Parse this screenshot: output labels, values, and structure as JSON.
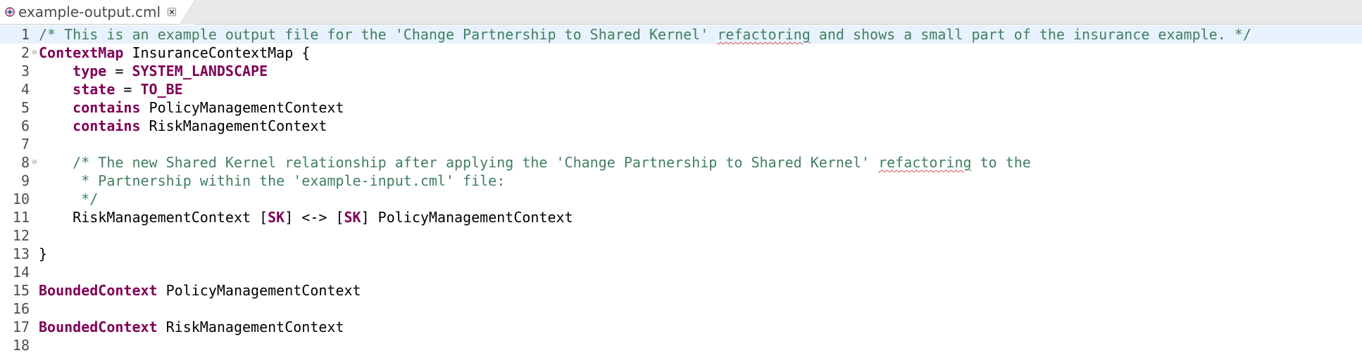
{
  "tab": {
    "label": "example-output.cml",
    "icon": "cml-file-icon",
    "close_glyph": "✕"
  },
  "colors": {
    "keyword": "#7f0055",
    "comment": "#3f7f5f",
    "current_line": "#e8f2fe",
    "spell_underline": "#e0504a"
  },
  "fold_glyph": "⊖",
  "lines": [
    {
      "num": "1",
      "current": true,
      "fold": false,
      "tokens": [
        {
          "t": "cm",
          "v": "/* This is an example output file for the 'Change Partnership to Shared Kernel' "
        },
        {
          "t": "cm-spell",
          "v": "refactoring"
        },
        {
          "t": "cm",
          "v": " and shows a small part of the insurance example. */"
        }
      ]
    },
    {
      "num": "2",
      "current": false,
      "fold": true,
      "tokens": [
        {
          "t": "kw",
          "v": "ContextMap"
        },
        {
          "t": "plain",
          "v": " InsuranceContextMap {"
        }
      ]
    },
    {
      "num": "3",
      "current": false,
      "fold": false,
      "tokens": [
        {
          "t": "plain",
          "v": "    "
        },
        {
          "t": "kw",
          "v": "type"
        },
        {
          "t": "plain",
          "v": " = "
        },
        {
          "t": "kw",
          "v": "SYSTEM_LANDSCAPE"
        }
      ]
    },
    {
      "num": "4",
      "current": false,
      "fold": false,
      "tokens": [
        {
          "t": "plain",
          "v": "    "
        },
        {
          "t": "kw",
          "v": "state"
        },
        {
          "t": "plain",
          "v": " = "
        },
        {
          "t": "kw",
          "v": "TO_BE"
        }
      ]
    },
    {
      "num": "5",
      "current": false,
      "fold": false,
      "tokens": [
        {
          "t": "plain",
          "v": "    "
        },
        {
          "t": "kw",
          "v": "contains"
        },
        {
          "t": "plain",
          "v": " PolicyManagementContext"
        }
      ]
    },
    {
      "num": "6",
      "current": false,
      "fold": false,
      "tokens": [
        {
          "t": "plain",
          "v": "    "
        },
        {
          "t": "kw",
          "v": "contains"
        },
        {
          "t": "plain",
          "v": " RiskManagementContext"
        }
      ]
    },
    {
      "num": "7",
      "current": false,
      "fold": false,
      "tokens": []
    },
    {
      "num": "8",
      "current": false,
      "fold": true,
      "tokens": [
        {
          "t": "plain",
          "v": "    "
        },
        {
          "t": "cm",
          "v": "/* The new Shared Kernel relationship after applying the 'Change Partnership to Shared Kernel' "
        },
        {
          "t": "cm-spell",
          "v": "refactoring"
        },
        {
          "t": "cm",
          "v": " to the"
        }
      ]
    },
    {
      "num": "9",
      "current": false,
      "fold": false,
      "tokens": [
        {
          "t": "cm",
          "v": "     * Partnership within the 'example-input.cml' file:"
        }
      ]
    },
    {
      "num": "10",
      "current": false,
      "fold": false,
      "tokens": [
        {
          "t": "cm",
          "v": "     */"
        }
      ]
    },
    {
      "num": "11",
      "current": false,
      "fold": false,
      "tokens": [
        {
          "t": "plain",
          "v": "    RiskManagementContext ["
        },
        {
          "t": "kw",
          "v": "SK"
        },
        {
          "t": "plain",
          "v": "] <-> ["
        },
        {
          "t": "kw",
          "v": "SK"
        },
        {
          "t": "plain",
          "v": "] PolicyManagementContext"
        }
      ]
    },
    {
      "num": "12",
      "current": false,
      "fold": false,
      "tokens": []
    },
    {
      "num": "13",
      "current": false,
      "fold": false,
      "tokens": [
        {
          "t": "plain",
          "v": "}"
        }
      ]
    },
    {
      "num": "14",
      "current": false,
      "fold": false,
      "tokens": []
    },
    {
      "num": "15",
      "current": false,
      "fold": false,
      "tokens": [
        {
          "t": "kw",
          "v": "BoundedContext"
        },
        {
          "t": "plain",
          "v": " PolicyManagementContext"
        }
      ]
    },
    {
      "num": "16",
      "current": false,
      "fold": false,
      "tokens": []
    },
    {
      "num": "17",
      "current": false,
      "fold": false,
      "tokens": [
        {
          "t": "kw",
          "v": "BoundedContext"
        },
        {
          "t": "plain",
          "v": " RiskManagementContext"
        }
      ]
    },
    {
      "num": "18",
      "current": false,
      "fold": false,
      "tokens": []
    }
  ]
}
